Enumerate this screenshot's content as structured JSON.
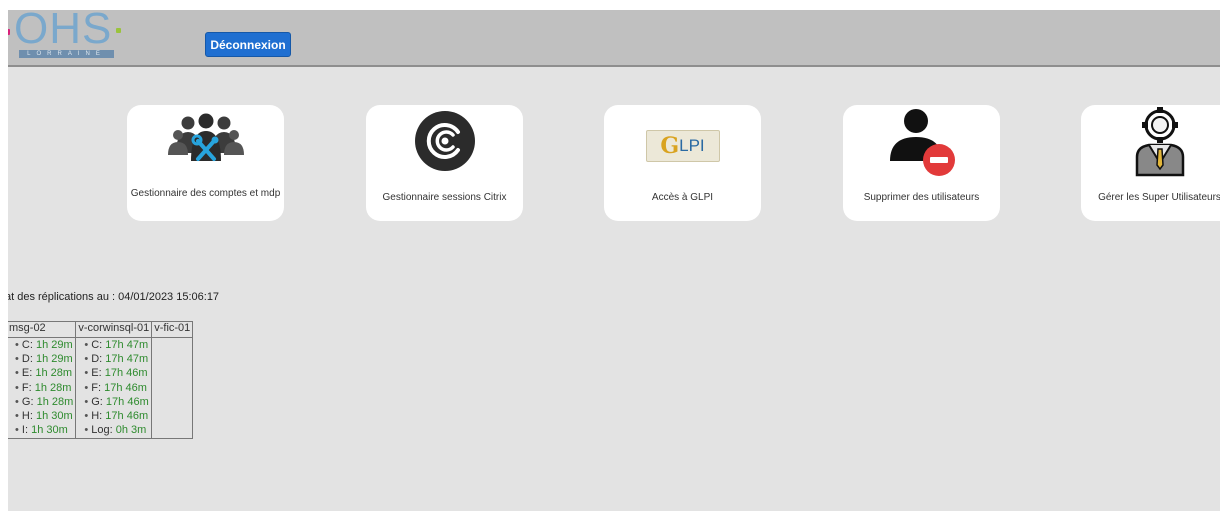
{
  "header": {
    "logo_text": "OHS",
    "logo_sub": "LORRAINE",
    "logout_label": "Déconnexion"
  },
  "tiles": [
    {
      "label": "Gestionnaire des comptes et mdp",
      "icon": "users-tools-icon"
    },
    {
      "label": "Gestionnaire sessions Citrix",
      "icon": "citrix-icon"
    },
    {
      "label": "Accès à GLPI",
      "icon": "glpi-icon",
      "icon_text": "LPI"
    },
    {
      "label": "Supprimer des utilisateurs",
      "icon": "user-remove-icon"
    },
    {
      "label": "Gérer les Super Utilisateurs",
      "icon": "super-user-icon"
    }
  ],
  "status": {
    "title": "at des réplications au : 04/01/2023 15:06:17"
  },
  "replication_table": {
    "headers": [
      "msg-02",
      "v-corwinsql-01",
      "v-fic-01"
    ],
    "columns": [
      [
        {
          "drive": "C:",
          "value": "1h 29m"
        },
        {
          "drive": "D:",
          "value": "1h 29m"
        },
        {
          "drive": "E:",
          "value": "1h 28m"
        },
        {
          "drive": "F:",
          "value": "1h 28m"
        },
        {
          "drive": "G:",
          "value": "1h 28m"
        },
        {
          "drive": "H:",
          "value": "1h 30m"
        },
        {
          "drive": "I:",
          "value": "1h 30m"
        }
      ],
      [
        {
          "drive": "C:",
          "value": "17h 47m"
        },
        {
          "drive": "D:",
          "value": "17h 47m"
        },
        {
          "drive": "E:",
          "value": "17h 46m"
        },
        {
          "drive": "F:",
          "value": "17h 46m"
        },
        {
          "drive": "G:",
          "value": "17h 46m"
        },
        {
          "drive": "H:",
          "value": "17h 46m"
        },
        {
          "drive": "Log:",
          "value": "0h 3m"
        }
      ],
      []
    ]
  },
  "colors": {
    "page_bg": "#e3e3e3",
    "header_bg": "#c0c0c0",
    "button_bg": "#1f6fd1",
    "value_green": "#2e8b2e",
    "remove_red": "#e23a3a"
  }
}
